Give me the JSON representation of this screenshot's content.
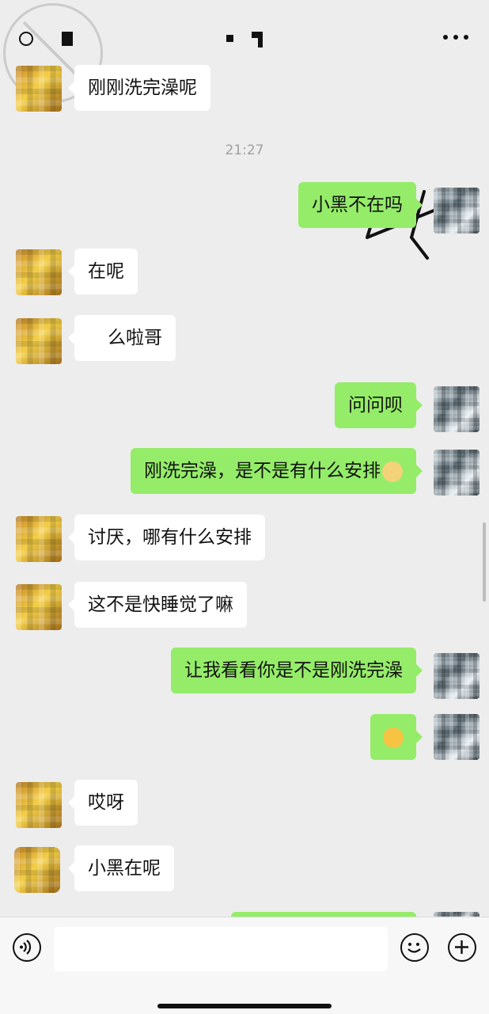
{
  "header": {
    "back_icon": "back-icon",
    "menu_icon": "more-icon"
  },
  "messages": [
    {
      "side": "left",
      "text": "刚刚洗完澡呢"
    },
    {
      "side": "time",
      "text": "21:27"
    },
    {
      "side": "right",
      "text": "小黑不在吗"
    },
    {
      "side": "left",
      "text": "在呢"
    },
    {
      "side": "left",
      "text": "么啦哥"
    },
    {
      "side": "right",
      "text": "问问呗"
    },
    {
      "side": "right",
      "text": "刚洗完澡，是不是有什么安排",
      "emoji": "cat-face-icon"
    },
    {
      "side": "left",
      "text": "讨厌，哪有什么安排"
    },
    {
      "side": "left",
      "text": "这不是快睡觉了嘛"
    },
    {
      "side": "right",
      "text": "让我看看你是不是刚洗完澡"
    },
    {
      "side": "right",
      "text": "",
      "emoji": "tongue-face-icon"
    },
    {
      "side": "left",
      "text": "哎呀"
    },
    {
      "side": "left",
      "text": "小黑在呢"
    }
  ],
  "annotation": {
    "handwriting": "4"
  },
  "input_bar": {
    "placeholder": "",
    "voice_icon": "voice-icon",
    "emoji_icon": "emoji-icon",
    "plus_icon": "plus-icon"
  },
  "colors": {
    "sent_bubble": "#95ec69",
    "received_bubble": "#ffffff",
    "background": "#ededed"
  }
}
